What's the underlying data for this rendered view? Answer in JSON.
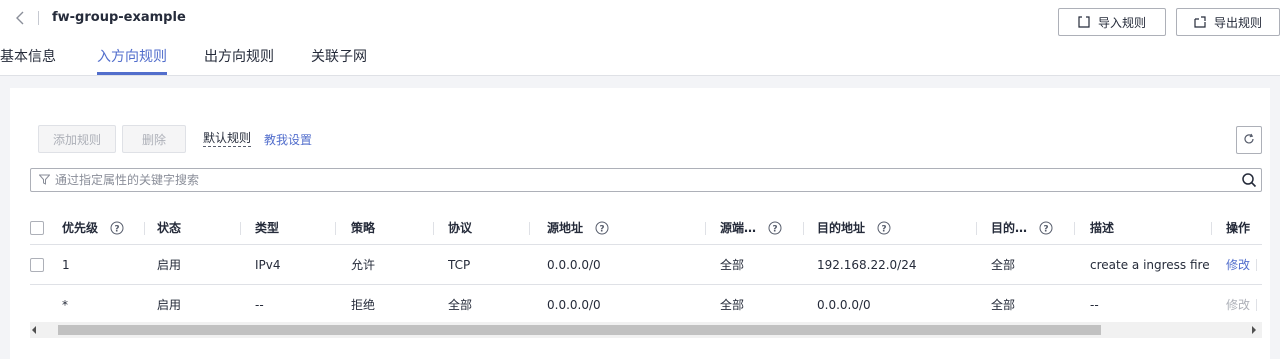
{
  "header": {
    "title": "fw-group-example",
    "import_label": "导入规则",
    "export_label": "导出规则"
  },
  "tabs": [
    {
      "label": "基本信息"
    },
    {
      "label": "入方向规则",
      "active": true
    },
    {
      "label": "出方向规则"
    },
    {
      "label": "关联子网"
    }
  ],
  "toolbar": {
    "add_label": "添加规则",
    "delete_label": "删除",
    "default_rule_label": "默认规则",
    "help_link_label": "教我设置"
  },
  "search": {
    "placeholder": "通过指定属性的关键字搜索"
  },
  "table": {
    "columns": [
      {
        "label": "优先级",
        "help": true
      },
      {
        "label": "状态"
      },
      {
        "label": "类型"
      },
      {
        "label": "策略"
      },
      {
        "label": "协议"
      },
      {
        "label": "源地址",
        "help": true
      },
      {
        "label": "源端…",
        "help": true
      },
      {
        "label": "目的地址",
        "help": true
      },
      {
        "label": "目的…",
        "help": true
      },
      {
        "label": "描述"
      },
      {
        "label": "操作"
      }
    ],
    "rows": [
      {
        "priority": "1",
        "status": "启用",
        "type": "IPv4",
        "policy": "允许",
        "protocol": "TCP",
        "source": "0.0.0.0/0",
        "source_port": "全部",
        "destination": "192.168.22.0/24",
        "dest_port": "全部",
        "description": "create a ingress fire…",
        "action": "修改"
      },
      {
        "priority": "*",
        "status": "启用",
        "type": "--",
        "policy": "拒绝",
        "protocol": "全部",
        "source": "0.0.0.0/0",
        "source_port": "全部",
        "destination": "0.0.0.0/0",
        "dest_port": "全部",
        "description": "--",
        "action": "修改"
      }
    ]
  },
  "colors": {
    "accent": "#526ecc",
    "text": "#252b3a",
    "disabled": "#adb0b8",
    "border": "#dfe1e6"
  }
}
